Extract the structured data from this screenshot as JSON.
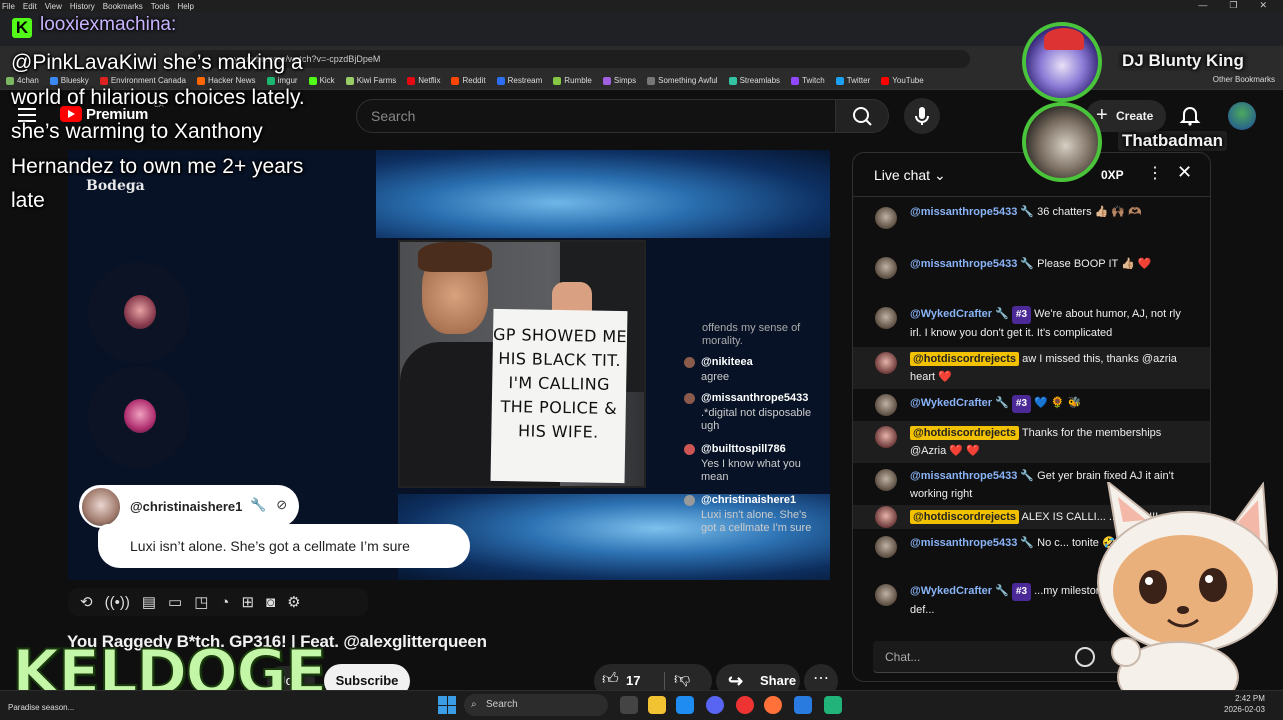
{
  "menubar": {
    "items": [
      "File",
      "Edit",
      "View",
      "History",
      "Bookmarks",
      "Tools",
      "Help"
    ]
  },
  "browser": {
    "url": "youtube.com/watch?v=-cpzdBjDpeM",
    "bookmarks": [
      {
        "label": "4chan",
        "color": "#7bb661"
      },
      {
        "label": "Bluesky",
        "color": "#3a88f5"
      },
      {
        "label": "Environment Canada",
        "color": "#d22"
      },
      {
        "label": "Hacker News",
        "color": "#ff6600"
      },
      {
        "label": "imgur",
        "color": "#1bb76e"
      },
      {
        "label": "Kick",
        "color": "#53fc18"
      },
      {
        "label": "Kiwi Farms",
        "color": "#9c6"
      },
      {
        "label": "Netflix",
        "color": "#e50914"
      },
      {
        "label": "Reddit",
        "color": "#ff4500"
      },
      {
        "label": "Restream",
        "color": "#2c6ef2"
      },
      {
        "label": "Rumble",
        "color": "#85c742"
      },
      {
        "label": "Simps",
        "color": "#a060e0"
      },
      {
        "label": "Something Awful",
        "color": "#777"
      },
      {
        "label": "Streamlabs",
        "color": "#31c3a2"
      },
      {
        "label": "Twitch",
        "color": "#9146ff"
      },
      {
        "label": "Twitter",
        "color": "#1da1f2"
      },
      {
        "label": "YouTube",
        "color": "#ff0000"
      }
    ],
    "other_bookmarks": "Other Bookmarks"
  },
  "youtube": {
    "premium_label": "Premium",
    "region": "CA",
    "search_placeholder": "Search",
    "create_label": "Create"
  },
  "video": {
    "watermark": "Bodega",
    "sign_text": "GP SHOWED ME HIS BLACK TIT. I'M CALLING THE POLICE & HIS WIFE.",
    "overlay_chat_fade": "offends my sense of morality.",
    "overlay_chat": [
      {
        "user": "@nikiteea",
        "text": "agree"
      },
      {
        "user": "@missanthrope5433",
        "text": ".*digital not disposable ugh"
      },
      {
        "user": "@builttospill786",
        "text": "Yes I know what you mean"
      },
      {
        "user": "@christinaishere1",
        "text": "Luxi isn't alone. She's got a cellmate I'm sure"
      }
    ],
    "nameplate_user": "@christinaishere1",
    "bubble_text": "Luxi isn’t alone. She’s got a cellmate I’m sure",
    "title": "You Raggedy B*tch. GP316! | Feat. @alexglitterqueen",
    "join_label": "Join",
    "subscribe_label": "Subscribe",
    "like_count": "17",
    "share_label": "Share"
  },
  "live_chat": {
    "title": "Live chat",
    "xp": "0XP",
    "input_placeholder": "Chat...",
    "messages": [
      {
        "user": "@missanthrope5433",
        "text": "36 chatters 👍🏼 🙌🏽 🫶🏽"
      },
      {
        "user": "@missanthrope5433",
        "text": "Please BOOP IT 👍🏼 ❤️"
      },
      {
        "user": "@WykedCrafter",
        "member": "#3",
        "text": "We're about humor, AJ, not rly irl. I know you don't get it. It's complicated"
      },
      {
        "user": "@hotdiscordrejects",
        "text": "aw I missed this, thanks @azria heart ❤️"
      },
      {
        "user": "@WykedCrafter",
        "member": "#3",
        "text": "💙 🌻 🐝"
      },
      {
        "user": "@hotdiscordrejects",
        "text": "Thanks for the memberships @Azria ❤️ ❤️"
      },
      {
        "user": "@missanthrope5433",
        "text": "Get yer brain fixed AJ it ain't working right"
      },
      {
        "user": "@hotdiscordrejects",
        "text": "ALEX IS CALLI... ...OY A !!!!"
      },
      {
        "user": "@missanthrope5433",
        "text": "No c... tonite 🤣"
      },
      {
        "user": "@WykedCrafter",
        "member": "#3",
        "text": "...my milestone 😬 but I won't def..."
      }
    ]
  },
  "overlays": {
    "alert_user": "looxiexmachina:",
    "alert_text": "@PinkLavaKiwi she’s making a world of hilarious choices lately. she’s warming to Xanthony Hernandez to own me 2+ years late",
    "brand": "KELDOGE",
    "dj_users": [
      "DJ Blunty King",
      "Thatbadman"
    ]
  },
  "taskbar": {
    "weather": "Paradise season...",
    "search_placeholder": "Search",
    "time": "2:42 PM",
    "date": "2026-02-03"
  },
  "colors": {
    "accent_youtube": "#ff0000",
    "highlight_username": "#f2c200",
    "kick_green": "#53fc18"
  }
}
